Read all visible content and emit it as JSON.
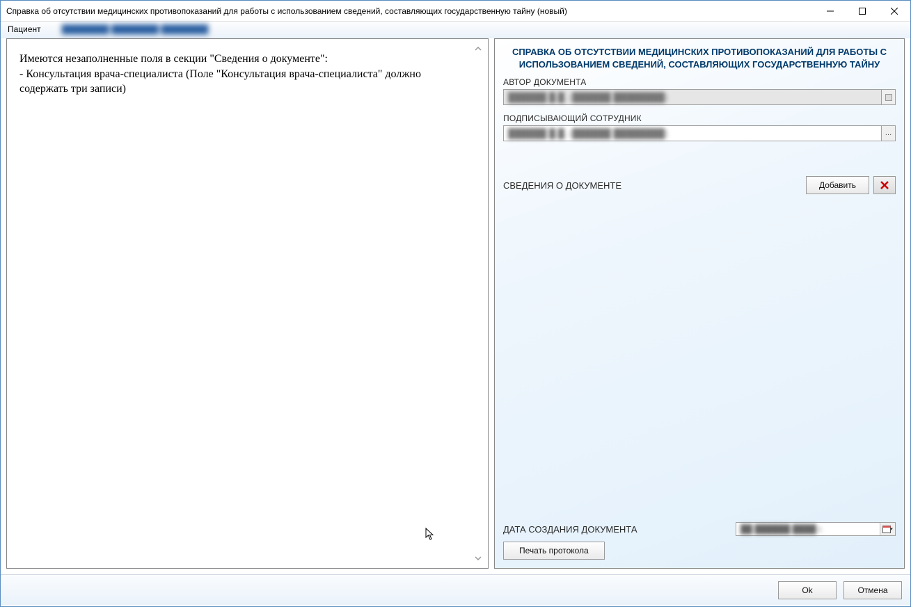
{
  "window": {
    "title": "Справка об отсутствии медицинских противопоказаний для работы с использованием сведений, составляющих государственную тайну (новый)"
  },
  "patient": {
    "label": "Пациент",
    "name_masked": "████████ ████████ ████████"
  },
  "left": {
    "line1": "Имеются незаполненные поля в секции \"Сведения о документе\":",
    "line2": "- Консультация врача-специалиста (Поле \"Консультация врача-специалиста\" должно содержать три записи)"
  },
  "right": {
    "heading": "СПРАВКА ОБ ОТСУТСТВИИ МЕДИЦИНСКИХ ПРОТИВОПОКАЗАНИЙ ДЛЯ РАБОТЫ С ИСПОЛЬЗОВАНИЕМ СВЕДЕНИЙ, СОСТАВЛЯЮЩИХ ГОСУДАРСТВЕННУЮ ТАЙНУ",
    "author_label": "АВТОР ДОКУМЕНТА",
    "author_value_masked": "██████ █.█. (██████ ████████)",
    "signer_label": "ПОДПИСЫВАЮЩИЙ СОТРУДНИК",
    "signer_value_masked": "██████ █.█. (██████ ████████)",
    "section_label": "СВЕДЕНИЯ О ДОКУМЕНТЕ",
    "add_button": "Добавить",
    "date_label": "ДАТА СОЗДАНИЯ ДОКУМЕНТА",
    "date_value_masked": "██ ██████ ████ г.",
    "print_button": "Печать протокола"
  },
  "footer": {
    "ok": "Ok",
    "cancel": "Отмена"
  }
}
